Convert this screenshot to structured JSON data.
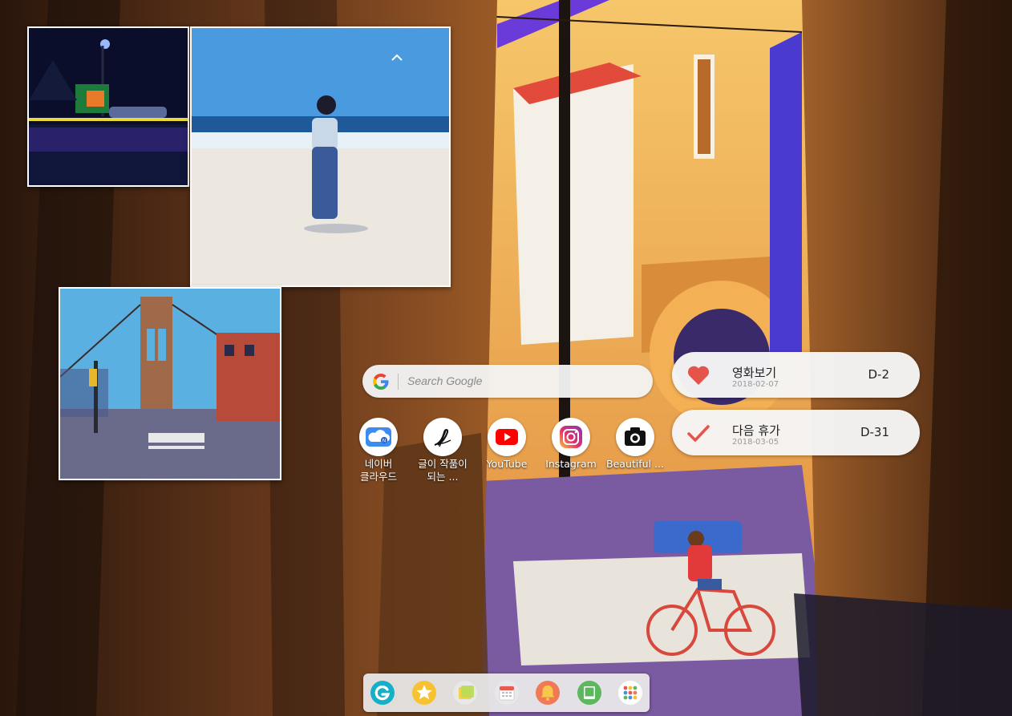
{
  "search": {
    "placeholder": "Search Google",
    "icon": "google-g-icon"
  },
  "photos": [
    {
      "subject": "night gas station",
      "icon": "photo-night"
    },
    {
      "subject": "girl on beach",
      "icon": "photo-beach"
    },
    {
      "subject": "bridge street",
      "icon": "photo-bridge"
    }
  ],
  "apps": [
    {
      "label": "네이버 클라우드",
      "icon": "naver-cloud-icon",
      "color": "#3c8cf0"
    },
    {
      "label": "글이 작품이 되는 ...",
      "icon": "pen-signature-icon",
      "color": "#000000"
    },
    {
      "label": "YouTube",
      "icon": "youtube-icon",
      "color": "#ff0000"
    },
    {
      "label": "Instagram",
      "icon": "instagram-icon",
      "color": "#c13584"
    },
    {
      "label": "Beautiful ...",
      "icon": "camera-icon",
      "color": "#111111"
    }
  ],
  "dday": [
    {
      "title": "영화보기",
      "date": "2018-02-07",
      "count": "D-2",
      "icon": "heart-icon",
      "color": "#e5534b"
    },
    {
      "title": "다음 휴가",
      "date": "2018-03-05",
      "count": "D-31",
      "icon": "checkmark-icon",
      "color": "#e5534b"
    }
  ],
  "dock": [
    {
      "icon": "launcher-g-icon",
      "color": "#15b0c8"
    },
    {
      "icon": "star-icon",
      "color": "#f6c231"
    },
    {
      "icon": "sticky-note-icon",
      "color": "#f2d24a"
    },
    {
      "icon": "calendar-icon",
      "color": "#e85a4f"
    },
    {
      "icon": "bell-icon",
      "color": "#f07a55"
    },
    {
      "icon": "tablet-icon",
      "color": "#5cb85c"
    },
    {
      "icon": "app-grid-icon",
      "color": "#4a90e2"
    }
  ]
}
